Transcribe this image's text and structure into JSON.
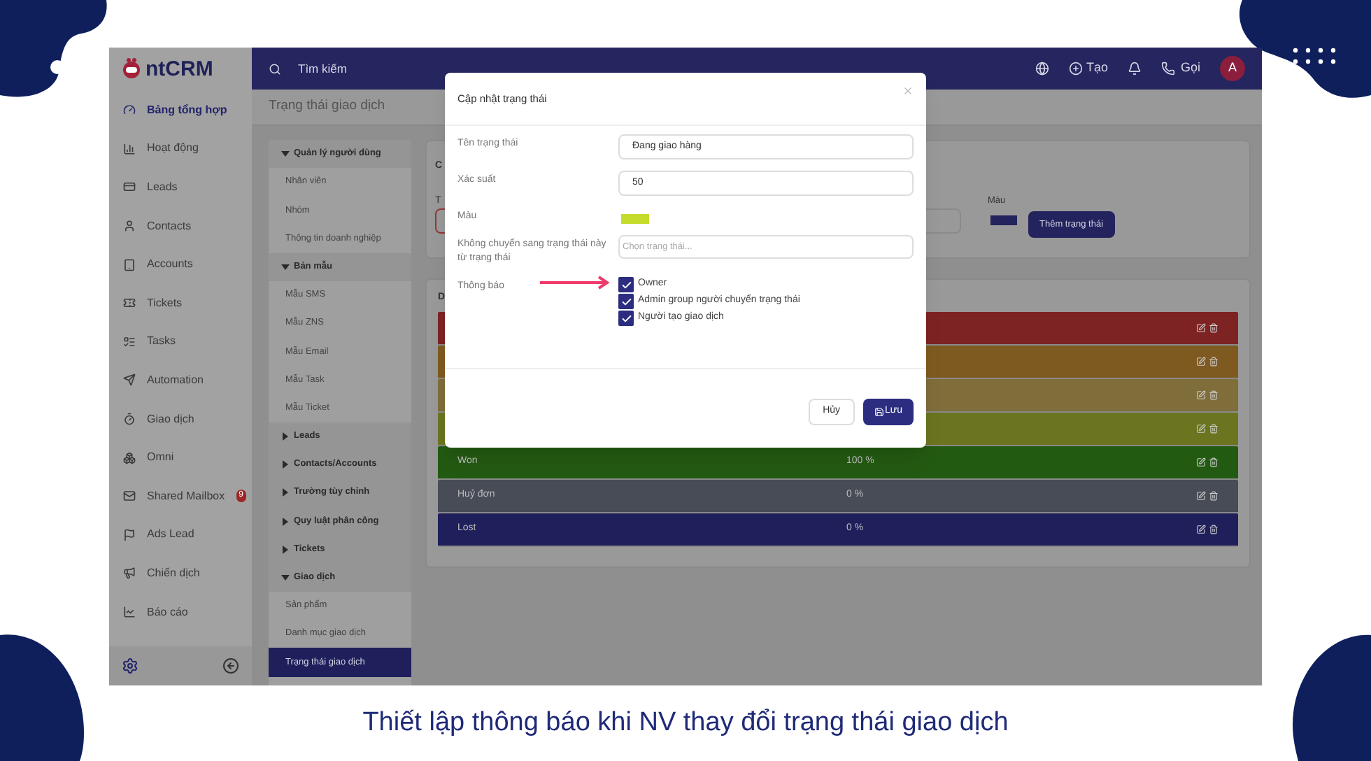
{
  "caption": "Thiết lập thông báo khi NV thay đổi trạng thái giao dịch",
  "logo": {
    "text": "ntCRM"
  },
  "sidebar": {
    "items": [
      {
        "label": "Bảng tổng hợp",
        "selected": true
      },
      {
        "label": "Hoạt động",
        "selected": false
      },
      {
        "label": "Leads",
        "selected": false
      },
      {
        "label": "Contacts",
        "selected": false
      },
      {
        "label": "Accounts",
        "selected": false
      },
      {
        "label": "Tickets",
        "selected": false
      },
      {
        "label": "Tasks",
        "selected": false
      },
      {
        "label": "Automation",
        "selected": false
      },
      {
        "label": "Giao dịch",
        "selected": false
      },
      {
        "label": "Omni",
        "selected": false
      },
      {
        "label": "Shared Mailbox",
        "selected": false,
        "badge": "9"
      },
      {
        "label": "Ads Lead",
        "selected": false
      },
      {
        "label": "Chiến dịch",
        "selected": false
      },
      {
        "label": "Báo cáo",
        "selected": false
      }
    ]
  },
  "topbar": {
    "search": {
      "placeholder": "Tìm kiếm"
    },
    "create": "Tạo",
    "call": "Gọi",
    "avatar": "A"
  },
  "page_title": "Trạng thái giao dịch",
  "settings_nav": [
    {
      "label": "Quản lý người dùng",
      "expanded": true,
      "children": [
        {
          "label": "Nhân viên",
          "selected": false
        },
        {
          "label": "Nhóm",
          "selected": false
        },
        {
          "label": "Thông tin doanh nghiệp",
          "selected": false
        }
      ]
    },
    {
      "label": "Bản mẫu",
      "expanded": true,
      "children": [
        {
          "label": "Mẫu SMS",
          "selected": false
        },
        {
          "label": "Mẫu ZNS",
          "selected": false
        },
        {
          "label": "Mẫu Email",
          "selected": false
        },
        {
          "label": "Mẫu Task",
          "selected": false
        },
        {
          "label": "Mẫu Ticket",
          "selected": false
        }
      ]
    },
    {
      "label": "Leads",
      "expanded": false
    },
    {
      "label": "Contacts/Accounts",
      "expanded": false
    },
    {
      "label": "Trường tùy chỉnh",
      "expanded": false
    },
    {
      "label": "Quy luật phân công",
      "expanded": false
    },
    {
      "label": "Tickets",
      "expanded": false
    },
    {
      "label": "Giao dịch",
      "expanded": true,
      "children": [
        {
          "label": "Sản phẩm",
          "selected": false
        },
        {
          "label": "Danh mục giao dịch",
          "selected": false
        },
        {
          "label": "Trạng thái giao dịch",
          "selected": true
        }
      ]
    }
  ],
  "add_card": {
    "title": "C",
    "field_label": "T",
    "color_label": "Màu",
    "color": "#23235e",
    "button": "Thêm trạng thái"
  },
  "list_card": {
    "title": "D",
    "rows": [
      {
        "color": "#7e2323"
      },
      {
        "color": "#7f5a20"
      },
      {
        "color": "#7f6d3a"
      },
      {
        "color": "#6b751f"
      },
      {
        "name": "Won",
        "probability": "100 %",
        "color": "#235a12"
      },
      {
        "name": "Huỷ đơn",
        "probability": "0 %",
        "color": "#474c57"
      },
      {
        "name": "Lost",
        "probability": "0 %",
        "color": "#1f1f5c"
      }
    ]
  },
  "modal": {
    "title": "Cập nhật trạng thái",
    "fields": [
      {
        "kind": "text",
        "label": "Tên trạng thái",
        "value": "Đang giao hàng"
      },
      {
        "kind": "text",
        "label": "Xác suất",
        "value": "50"
      },
      {
        "kind": "color",
        "label": "Màu",
        "color": "#c6dc2a"
      },
      {
        "kind": "select",
        "label": "Không chuyển sang trạng thái này từ trạng thái",
        "placeholder": "Chọn trạng thái..."
      },
      {
        "kind": "checks",
        "label": "Thông báo",
        "options": [
          {
            "label": "Owner",
            "checked": true
          },
          {
            "label": "Admin group người chuyển trạng thái",
            "checked": true
          },
          {
            "label": "Người tạo giao dịch",
            "checked": true
          }
        ]
      }
    ],
    "cancel": "Hủy",
    "save": "Lưu"
  }
}
